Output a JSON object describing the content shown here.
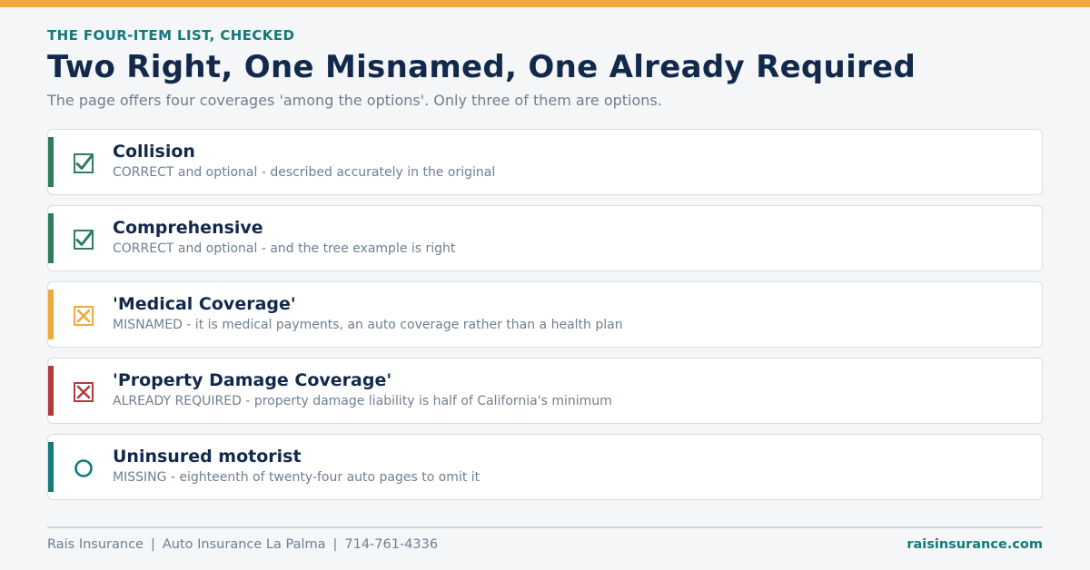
{
  "colors": {
    "accent_orange": "#f0a93a",
    "teal": "#127a7a",
    "green": "#2e7d5b",
    "red": "#b23a3a",
    "navy": "#13294b",
    "muted": "#6f7f8f"
  },
  "header": {
    "eyebrow": "THE FOUR-ITEM LIST, CHECKED",
    "title": "Two Right, One Misnamed, One Already Required",
    "subtitle": "The page offers four coverages 'among the options'. Only three of them are options."
  },
  "items": [
    {
      "title": "Collision",
      "description": "CORRECT and optional - described accurately in the original",
      "status": "correct",
      "icon": "checked-box-icon",
      "color": "#2e7d5b"
    },
    {
      "title": "Comprehensive",
      "description": "CORRECT and optional - and the tree example is right",
      "status": "correct",
      "icon": "checked-box-icon",
      "color": "#2e7d5b"
    },
    {
      "title": "'Medical Coverage'",
      "description": "MISNAMED - it is medical payments, an auto coverage rather than a health plan",
      "status": "misnamed",
      "icon": "crossed-box-icon",
      "color": "#f0a93a"
    },
    {
      "title": "'Property Damage Coverage'",
      "description": "ALREADY REQUIRED - property damage liability is half of California's minimum",
      "status": "required",
      "icon": "crossed-box-icon",
      "color": "#b23a3a"
    },
    {
      "title": "Uninsured motorist",
      "description": "MISSING - eighteenth of twenty-four auto pages to omit it",
      "status": "missing",
      "icon": "empty-circle-icon",
      "color": "#127a7a"
    }
  ],
  "footer": {
    "brand": "Rais Insurance",
    "separator": "|",
    "page": "Auto Insurance La Palma",
    "phone": "714-761-4336",
    "website": "raisinsurance.com"
  }
}
